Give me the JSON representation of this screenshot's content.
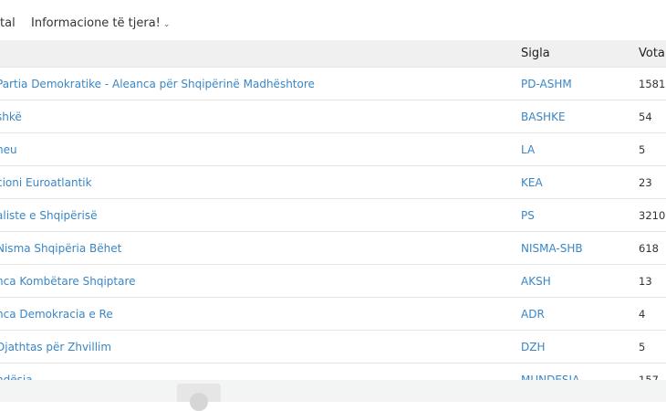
{
  "nav": {
    "item1": "tal",
    "item2": "Informacione të tjera!",
    "chevron": "⌄"
  },
  "table": {
    "headers": {
      "name": "",
      "sigla": "Sigla",
      "vota": "Vota"
    },
    "rows": [
      {
        "name": "Partia Demokratike - Aleanca për Shqipërinë Madhështore",
        "sigla": "PD-ASHM",
        "vota": "1581"
      },
      {
        "name": "shkë",
        "sigla": "BASHKE",
        "vota": "54"
      },
      {
        "name": "heu",
        "sigla": "LA",
        "vota": "5"
      },
      {
        "name": "cioni Euroatlantik",
        "sigla": "KEA",
        "vota": "23"
      },
      {
        "name": "aliste e Shqipërisë",
        "sigla": "PS",
        "vota": "3210"
      },
      {
        "name": "Nisma Shqipëria Bëhet",
        "sigla": "NISMA-SHB",
        "vota": "618"
      },
      {
        "name": "nca Kombëtare Shqiptare",
        "sigla": "AKSH",
        "vota": "13"
      },
      {
        "name": "nca Demokracia e Re",
        "sigla": "ADR",
        "vota": "4"
      },
      {
        "name": "Djathtas për Zhvillim",
        "sigla": "DZH",
        "vota": "5"
      },
      {
        "name": "ndësia",
        "sigla": "MUNDESIA",
        "vota": "157"
      }
    ]
  }
}
